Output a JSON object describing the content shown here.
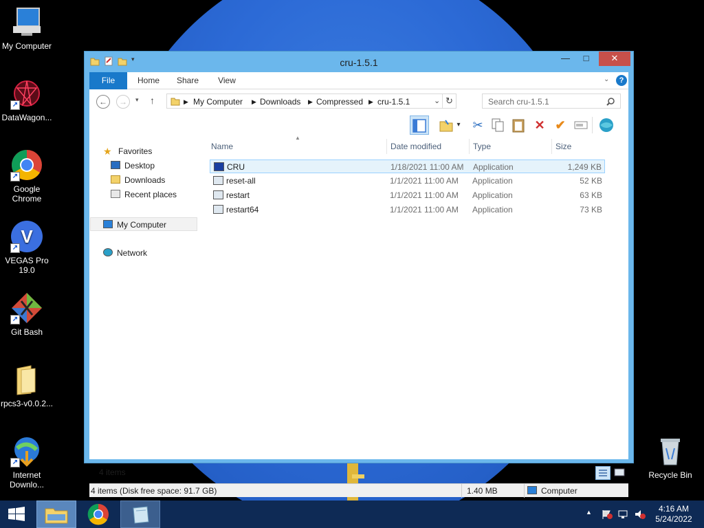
{
  "desktop": {
    "icons": [
      {
        "label": "My Computer"
      },
      {
        "label": "DataWagon..."
      },
      {
        "label": "Google Chrome"
      },
      {
        "label": "VEGAS Pro 19.0"
      },
      {
        "label": "Git Bash"
      },
      {
        "label": "rpcs3-v0.0.2..."
      },
      {
        "label": "Internet Downlo..."
      },
      {
        "label": "Recycle Bin"
      }
    ]
  },
  "window": {
    "title": "cru-1.5.1",
    "tabs": [
      "File",
      "Home",
      "Share",
      "View"
    ],
    "breadcrumb": [
      "My Computer",
      "Downloads",
      "Compressed",
      "cru-1.5.1"
    ],
    "search_placeholder": "Search cru-1.5.1",
    "nav": {
      "favorites": "Favorites",
      "desktop": "Desktop",
      "downloads": "Downloads",
      "recent": "Recent places",
      "computer": "My Computer",
      "network": "Network"
    },
    "columns": [
      "Name",
      "Date modified",
      "Type",
      "Size"
    ],
    "files": [
      {
        "name": "CRU",
        "date": "1/18/2021 11:00 AM",
        "type": "Application",
        "size": "1,249 KB"
      },
      {
        "name": "reset-all",
        "date": "1/1/2021 11:00 AM",
        "type": "Application",
        "size": "52 KB"
      },
      {
        "name": "restart",
        "date": "1/1/2021 11:00 AM",
        "type": "Application",
        "size": "63 KB"
      },
      {
        "name": "restart64",
        "date": "1/1/2021 11:00 AM",
        "type": "Application",
        "size": "73 KB"
      }
    ],
    "item_count": "4 items",
    "status_left": "4 items (Disk free space: 91.7 GB)",
    "status_size": "1.40 MB",
    "status_location": "Computer"
  },
  "taskbar": {
    "time": "4:16 AM",
    "date": "5/24/2022"
  },
  "colors": {
    "accent": "#1979ca",
    "window_frame": "#6bb7ec",
    "taskbar": "#0e2a55"
  }
}
